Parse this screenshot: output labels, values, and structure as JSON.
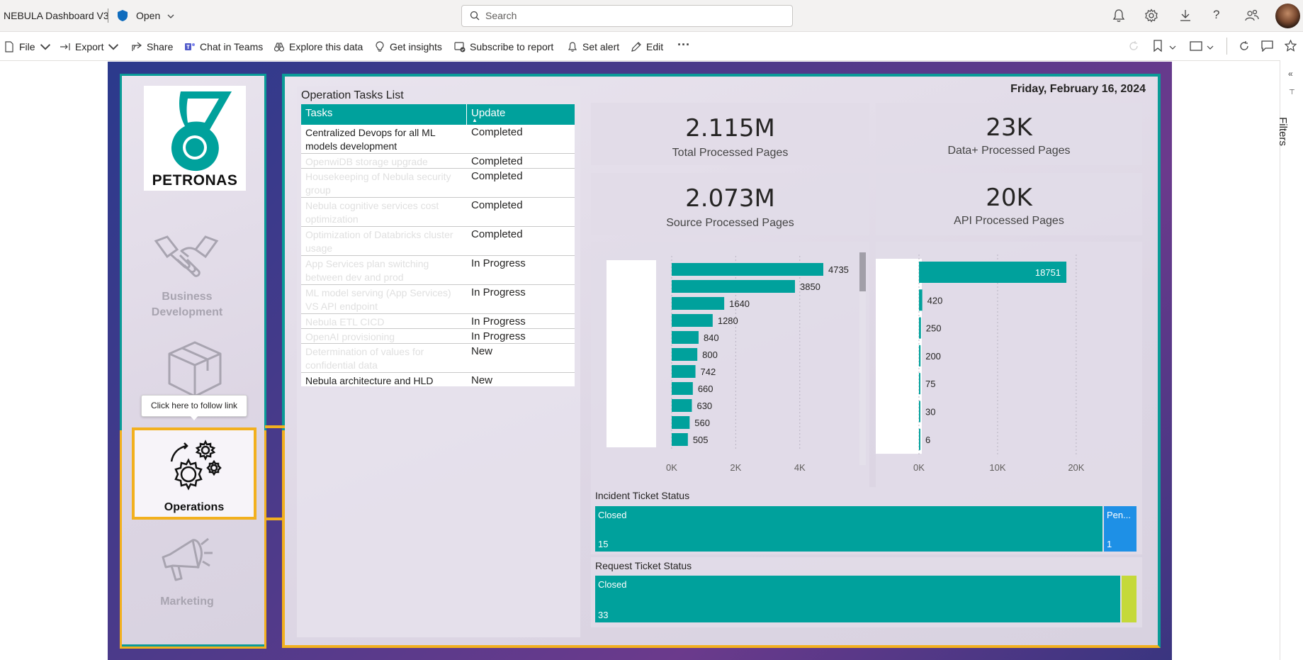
{
  "topbar": {
    "title": "NEBULA Dashboard V3",
    "status": "Open",
    "search_placeholder": "Search"
  },
  "toolbar": {
    "file": "File",
    "export": "Export",
    "share": "Share",
    "chat": "Chat in Teams",
    "explore": "Explore this data",
    "insights": "Get insights",
    "subscribe": "Subscribe to report",
    "alert": "Set alert",
    "edit": "Edit",
    "more": "···"
  },
  "filters_label": "Filters",
  "brand": {
    "name": "PETRONAS",
    "color": "#00a19c"
  },
  "nav": {
    "business": "Business Development",
    "tooltip": "Click here to follow link",
    "operations": "Operations",
    "marketing": "Marketing"
  },
  "tasks": {
    "title": "Operation Tasks List",
    "headers": [
      "Tasks",
      "Update"
    ],
    "rows": [
      {
        "task": "Centralized Devops for all ML models development",
        "update": "Completed"
      },
      {
        "task": "OpenwiDB storage upgrade",
        "update": "Completed"
      },
      {
        "task": "Housekeeping of Nebula security group",
        "update": "Completed"
      },
      {
        "task": "Nebula cognitive services cost optimization",
        "update": "Completed"
      },
      {
        "task": "Optimization of Databricks cluster usage",
        "update": "Completed"
      },
      {
        "task": "App Services plan switching between dev and prod",
        "update": "In Progress"
      },
      {
        "task": "ML model serving (App Services) VS API endpoint",
        "update": "In Progress"
      },
      {
        "task": "Nebula ETL CICD",
        "update": "In Progress"
      },
      {
        "task": "OpenAI provisioning",
        "update": "In Progress"
      },
      {
        "task": "Determination of values for confidential data",
        "update": "New"
      },
      {
        "task": "Nebula architecture and HLD",
        "update": "New"
      }
    ]
  },
  "date": "Friday, February 16, 2024",
  "kpis": [
    {
      "value": "2.115M",
      "label": "Total Processed Pages"
    },
    {
      "value": "23K",
      "label": "Data+ Processed Pages"
    },
    {
      "value": "2.073M",
      "label": "Source Processed Pages"
    },
    {
      "value": "20K",
      "label": "API Processed Pages"
    }
  ],
  "chart_data": [
    {
      "type": "bar",
      "orientation": "horizontal",
      "values": [
        4735,
        3850,
        1640,
        1280,
        840,
        800,
        742,
        660,
        630,
        560,
        505
      ],
      "xticks": [
        "0K",
        "2K",
        "4K"
      ],
      "xlim": [
        0,
        5200
      ],
      "color": "#00a19c"
    },
    {
      "type": "bar",
      "orientation": "horizontal",
      "values": [
        18751,
        420,
        250,
        200,
        75,
        30,
        6
      ],
      "xticks": [
        "0K",
        "10K",
        "20K"
      ],
      "xlim": [
        0,
        21000
      ],
      "color": "#00a19c"
    }
  ],
  "incident": {
    "title": "Incident Ticket Status",
    "segments": [
      {
        "label": "Closed",
        "count": "15",
        "value": 15,
        "color": "#00a19c"
      },
      {
        "label": "Pen...",
        "count": "1",
        "value": 1,
        "color": "#1e90e6"
      }
    ]
  },
  "request": {
    "title": "Request Ticket Status",
    "segments": [
      {
        "label": "Closed",
        "count": "33",
        "value": 33,
        "color": "#00a19c"
      },
      {
        "label": "",
        "count": "",
        "value": 1,
        "color": "#c5d93a"
      }
    ]
  }
}
